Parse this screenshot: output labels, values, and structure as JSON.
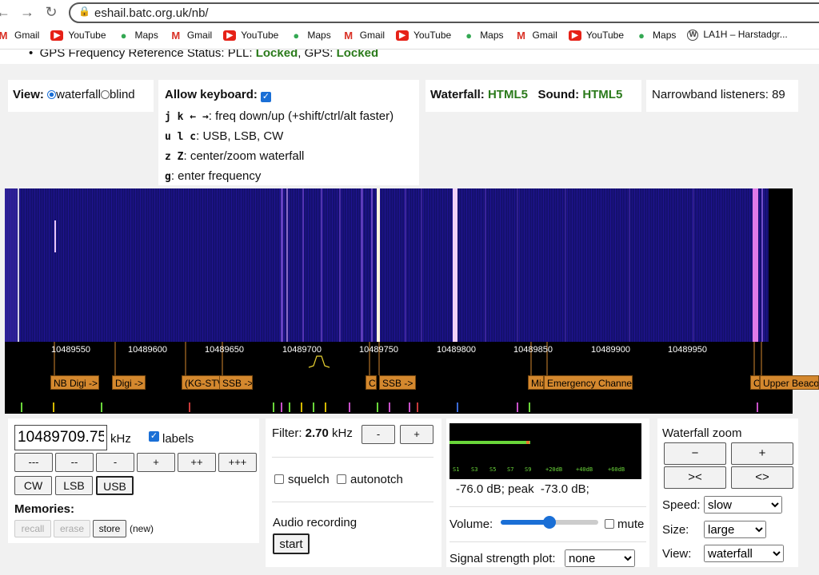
{
  "browser": {
    "url": "eshail.batc.org.uk/nb/",
    "bookmarks": [
      {
        "label": "Gmail",
        "icon": "gmail-icon"
      },
      {
        "label": "YouTube",
        "icon": "youtube-icon"
      },
      {
        "label": "Maps",
        "icon": "maps-icon"
      },
      {
        "label": "Gmail",
        "icon": "gmail-icon"
      },
      {
        "label": "YouTube",
        "icon": "youtube-icon"
      },
      {
        "label": "Maps",
        "icon": "maps-icon"
      },
      {
        "label": "Gmail",
        "icon": "gmail-icon"
      },
      {
        "label": "YouTube",
        "icon": "youtube-icon"
      },
      {
        "label": "Maps",
        "icon": "maps-icon"
      },
      {
        "label": "Gmail",
        "icon": "gmail-icon"
      },
      {
        "label": "YouTube",
        "icon": "youtube-icon"
      },
      {
        "label": "Maps",
        "icon": "maps-icon"
      },
      {
        "label": "LA1H – Harstadgr...",
        "icon": "wordpress-icon"
      }
    ]
  },
  "gps": {
    "prefix": "GPS Frequency Reference Status: PLL: ",
    "pll": "Locked",
    "mid": ", GPS: ",
    "gps": "Locked"
  },
  "view_panel": {
    "label": "View:",
    "opt_waterfall": "waterfall",
    "opt_blind": "blind"
  },
  "keyboard_panel": {
    "title": "Allow keyboard:",
    "lines": [
      {
        "keys": "j k ← →",
        "desc": ": freq down/up (+shift/ctrl/alt faster)"
      },
      {
        "keys": "u l c",
        "desc": ": USB, LSB, CW"
      },
      {
        "keys": "z Z",
        "desc": ": center/zoom waterfall"
      },
      {
        "keys": "g",
        "desc": ": enter frequency"
      }
    ]
  },
  "status_panel": {
    "waterfall_label": "Waterfall:",
    "waterfall_value": "HTML5",
    "sound_label": "Sound:",
    "sound_value": "HTML5"
  },
  "listeners": {
    "text": "Narrowband listeners: 89"
  },
  "scale": {
    "ticks": [
      "10489550",
      "10489600",
      "10489650",
      "10489700",
      "10489750",
      "10489800",
      "10489850",
      "10489900",
      "10489950"
    ],
    "labels": [
      "NB Digi ->",
      "Digi ->",
      "(KG-STV",
      "SSB ->",
      "CW",
      "SSB ->",
      "Mix",
      "Emergency Channel",
      "C",
      "Upper Beacon"
    ]
  },
  "freq_panel": {
    "value": "10489709.75",
    "unit": "kHz",
    "labels_toggle": "labels",
    "step_buttons": [
      "---",
      "--",
      "-",
      "+",
      "++",
      "+++"
    ],
    "mode_buttons": [
      "CW",
      "LSB",
      "USB"
    ],
    "memories_title": "Memories:",
    "recall": "recall",
    "erase": "erase",
    "store": "store",
    "new_label": "(new)"
  },
  "filter_panel": {
    "label": "Filter:",
    "value": "2.70",
    "unit": "kHz",
    "minus": "-",
    "plus": "+",
    "squelch": "squelch",
    "autonotch": "autonotch",
    "audio_title": "Audio recording",
    "start": "start"
  },
  "signal_panel": {
    "meter_labels": [
      "S1",
      "S3",
      "S5",
      "S7",
      "S9",
      "+20dB",
      "+40dB",
      "+60dB"
    ],
    "meter_level": 0.42,
    "readout": "-76.0 dB; peak  -73.0 dB;",
    "volume_label": "Volume:",
    "volume_level": 0.5,
    "mute": "mute",
    "plot_label": "Signal strength plot:",
    "plot_value": "none"
  },
  "zoom_panel": {
    "title": "Waterfall zoom",
    "buttons": [
      "−",
      "+",
      "><",
      "<>"
    ],
    "speed_label": "Speed:",
    "speed_value": "slow",
    "size_label": "Size:",
    "size_value": "large",
    "view_label": "View:",
    "view_value": "waterfall"
  },
  "colors": {
    "waterfall_bg": "#140d72",
    "label_orange": "#d4882e",
    "locked_green": "#2a7a1a",
    "meter_green": "#6ad63a"
  }
}
